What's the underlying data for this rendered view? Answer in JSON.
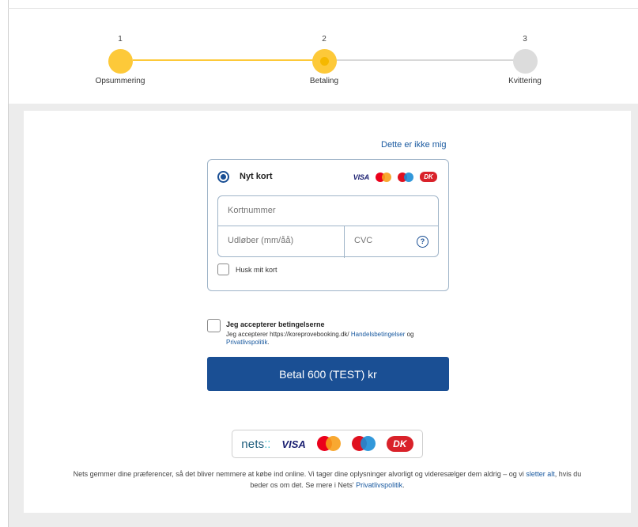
{
  "stepper": {
    "steps": [
      {
        "number": "1",
        "label": "Opsummering",
        "state": "done"
      },
      {
        "number": "2",
        "label": "Betaling",
        "state": "active"
      },
      {
        "number": "3",
        "label": "Kvittering",
        "state": "todo"
      }
    ]
  },
  "colors": {
    "accent": "#fdc939",
    "primary": "#1a4f94",
    "link": "#1a5aa0"
  },
  "payment": {
    "not_me_link": "Dette er ikke mig",
    "method_label": "Nyt kort",
    "brands": {
      "visa": "VISA",
      "dankort": "DK"
    },
    "card_number_placeholder": "Kortnummer",
    "expiry_placeholder": "Udløber (mm/åå)",
    "cvc_placeholder": "CVC",
    "cvc_help": "?",
    "remember_label": "Husk mit kort"
  },
  "terms": {
    "title": "Jeg accepterer betingelserne",
    "text_prefix": "Jeg accepterer https://koreprovebooking.dk/ ",
    "terms_link": "Handelsbetingelser",
    "text_mid": " og ",
    "privacy_link": "Privatlivspolitik",
    "text_suffix": "."
  },
  "pay_button": "Betal 600 (TEST) kr",
  "nets_logo": {
    "name": "nets",
    "dots": "⁚⁚"
  },
  "footer": {
    "text1": "Nets gemmer dine præferencer, så det bliver nemmere at købe ind online. Vi tager dine oplysninger alvorligt og videresælger dem aldrig – og vi ",
    "delete_link": "sletter alt",
    "text2": ", hvis du beder os om det. Se mere i Nets' ",
    "privacy_link": "Privatlivspolitik",
    "text3": "."
  }
}
